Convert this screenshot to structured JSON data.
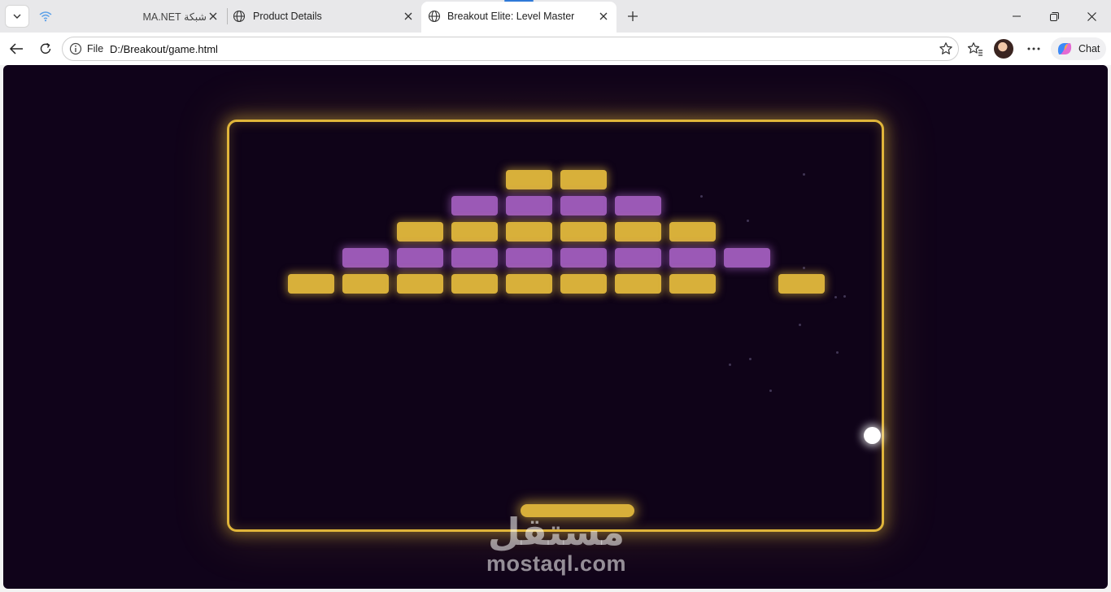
{
  "browser": {
    "tabs": [
      {
        "title": "شبكة MA.NET",
        "active": false
      },
      {
        "title": "Product Details",
        "active": false
      },
      {
        "title": "Breakout Elite: Level Master",
        "active": true
      }
    ],
    "address": {
      "scheme": "File",
      "url": "D:/Breakout/game.html"
    },
    "chat_label": "Chat",
    "accent_color": "#2f7ad8"
  },
  "game": {
    "colors": {
      "gold": "#d8b03a",
      "purple": "#9b59b6",
      "background": "#10031a",
      "border": "#e0b53a"
    },
    "brick_rows": [
      {
        "color": "gold",
        "columns": [
          4,
          5
        ]
      },
      {
        "color": "purple",
        "columns": [
          3,
          4,
          5,
          6
        ]
      },
      {
        "color": "gold",
        "columns": [
          2,
          3,
          4,
          5,
          6,
          7
        ]
      },
      {
        "color": "purple",
        "columns": [
          1,
          2,
          3,
          4,
          5,
          6,
          7,
          8
        ]
      },
      {
        "color": "gold",
        "columns": [
          0,
          1,
          2,
          3,
          4,
          5,
          6,
          7,
          9
        ]
      }
    ]
  },
  "watermark": {
    "arabic": "مستقل",
    "latin": "mostaql.com"
  }
}
